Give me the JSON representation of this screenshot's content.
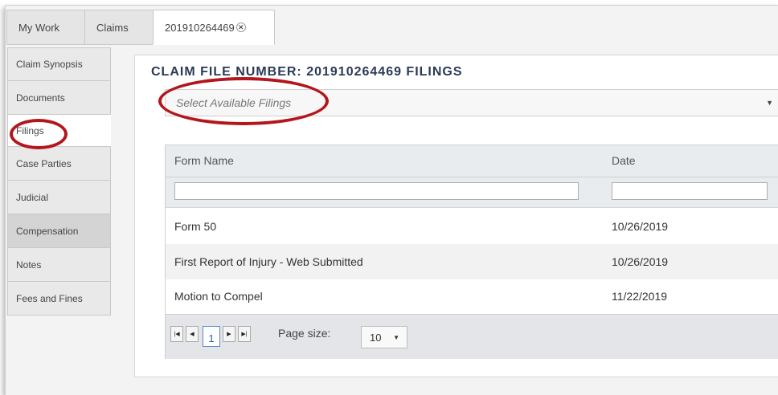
{
  "tabs": [
    {
      "label": "My Work"
    },
    {
      "label": "Claims"
    },
    {
      "label": "201910264469"
    }
  ],
  "sidebar": {
    "items": [
      {
        "label": "Claim Synopsis"
      },
      {
        "label": "Documents"
      },
      {
        "label": "Filings"
      },
      {
        "label": "Case Parties"
      },
      {
        "label": "Judicial"
      },
      {
        "label": "Compensation"
      },
      {
        "label": "Notes"
      },
      {
        "label": "Fees and Fines"
      }
    ]
  },
  "main": {
    "title": "CLAIM FILE NUMBER:  201910264469  FILINGS",
    "filings_dropdown": {
      "placeholder": "Select Available Filings"
    },
    "grid": {
      "columns": [
        "Form Name",
        "Date"
      ],
      "rows": [
        {
          "form_name": "Form 50",
          "date": "10/26/2019"
        },
        {
          "form_name": "First Report of Injury - Web Submitted",
          "date": "10/26/2019"
        },
        {
          "form_name": "Motion to Compel",
          "date": "11/22/2019"
        }
      ],
      "pager": {
        "current_page": "1",
        "page_size_label": "Page size:",
        "page_size_value": "10"
      }
    }
  },
  "colors": {
    "annotation_oval": "#b3161c",
    "title_text": "#2a3a55",
    "active_page": "#2f5fa6"
  },
  "icons": {
    "tab_close": "close-icon",
    "dropdown": "caret-down-icon",
    "pager_first": "first-page-icon",
    "pager_prev": "prev-page-icon",
    "pager_next": "next-page-icon",
    "pager_last": "last-page-icon"
  }
}
